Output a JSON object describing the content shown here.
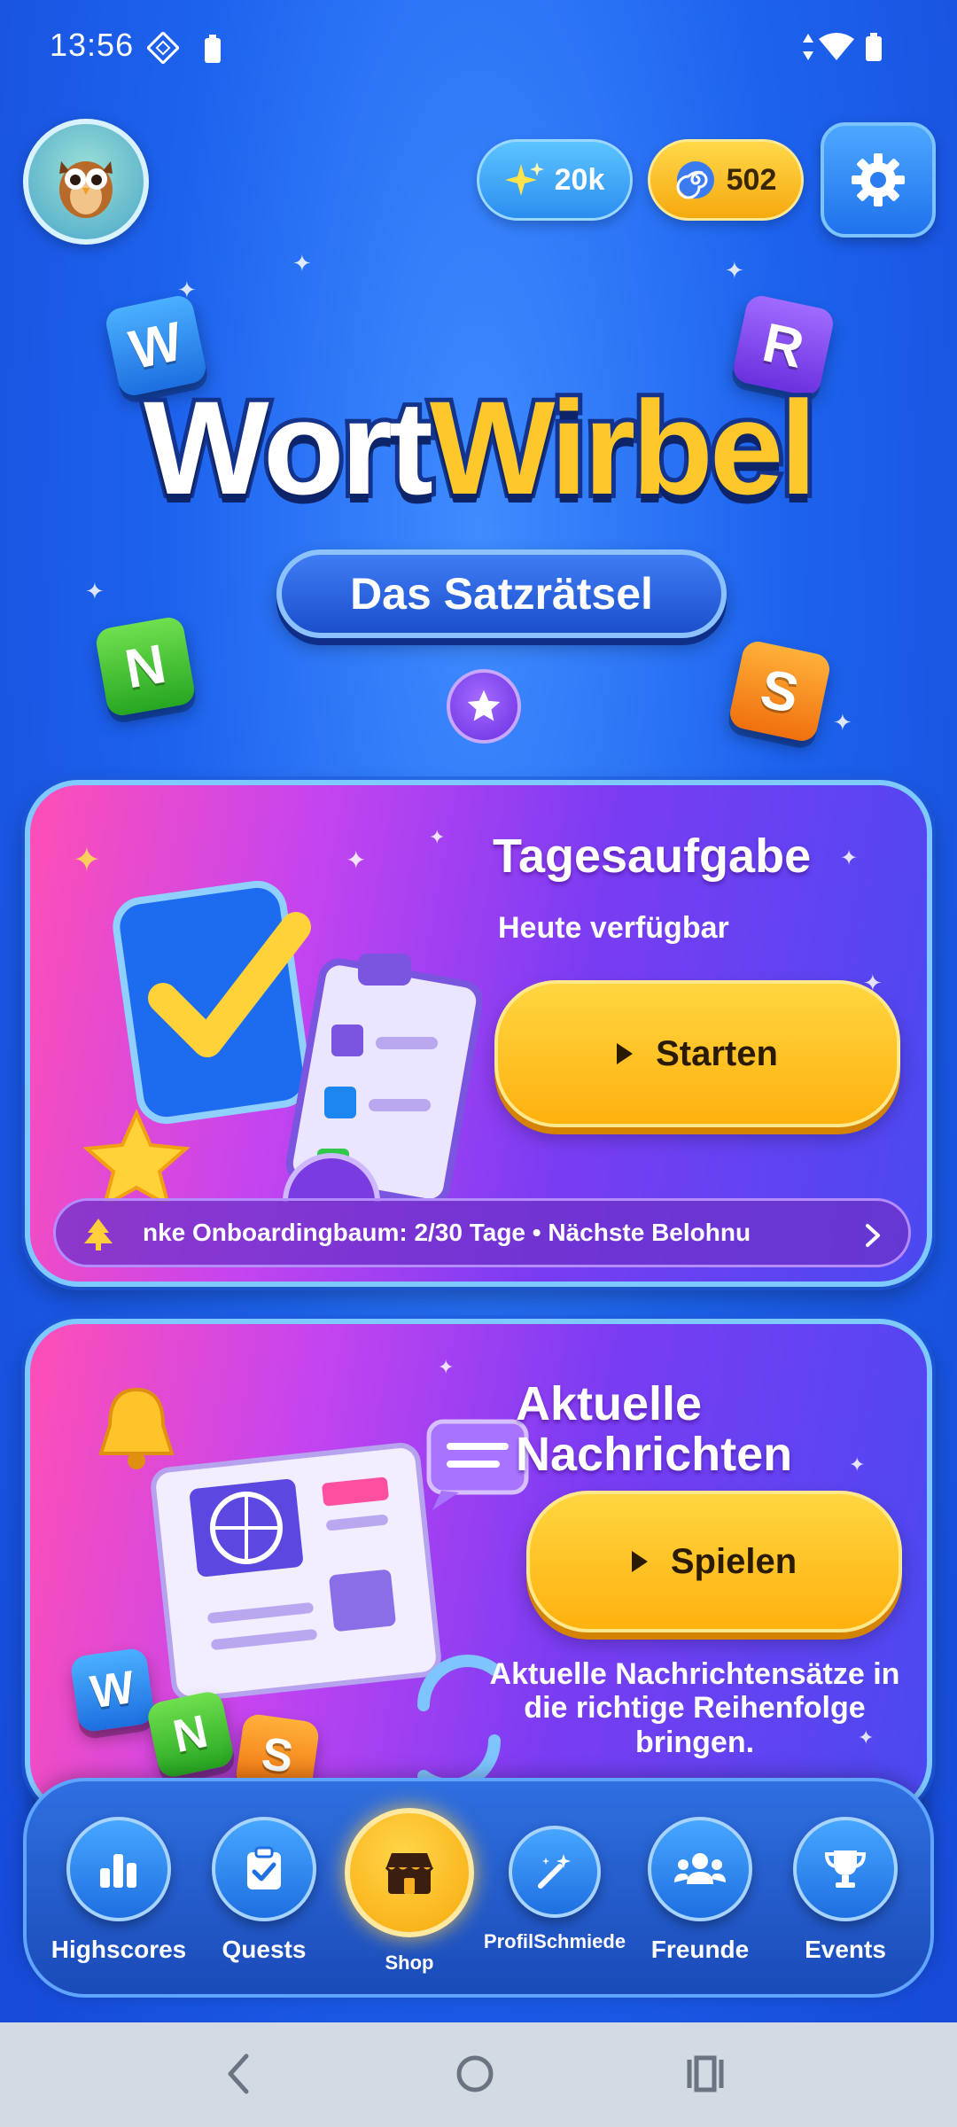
{
  "status_bar": {
    "time": "13:56"
  },
  "header": {
    "stars_value": "20k",
    "coins_value": "502"
  },
  "logo": {
    "title_part1": "Wort",
    "title_part2": "Wirbel",
    "subtitle": "Das Satzrätsel",
    "tiles": [
      "W",
      "R",
      "N",
      "S"
    ]
  },
  "daily_card": {
    "title": "Tagesaufgabe",
    "subtitle": "Heute verfügbar",
    "button_label": "Starten",
    "ticker_text": "nke    Onboardingbaum: 2/30 Tage • Nächste Belohnu"
  },
  "news_card": {
    "title_line1": "Aktuelle",
    "title_line2": "Nachrichten",
    "button_label": "Spielen",
    "description": "Aktuelle Nachrichtensätze in die richtige Reihenfolge bringen.",
    "tiles": [
      "W",
      "N",
      "S"
    ]
  },
  "bottom_nav": {
    "items": [
      {
        "label": "Highscores",
        "icon": "bar-chart-icon"
      },
      {
        "label": "Quests",
        "icon": "clipboard-check-icon"
      },
      {
        "label": "Shop",
        "icon": "shop-icon"
      },
      {
        "label": "ProfilSchmiede",
        "icon": "magic-wand-icon"
      },
      {
        "label": "Freunde",
        "icon": "people-icon"
      },
      {
        "label": "Events",
        "icon": "trophy-icon"
      }
    ]
  },
  "colors": {
    "background": "#1d63ee",
    "accent_yellow": "#ffc82a",
    "card_pink": "#ff4fb6",
    "card_purple": "#7a3cf2"
  }
}
